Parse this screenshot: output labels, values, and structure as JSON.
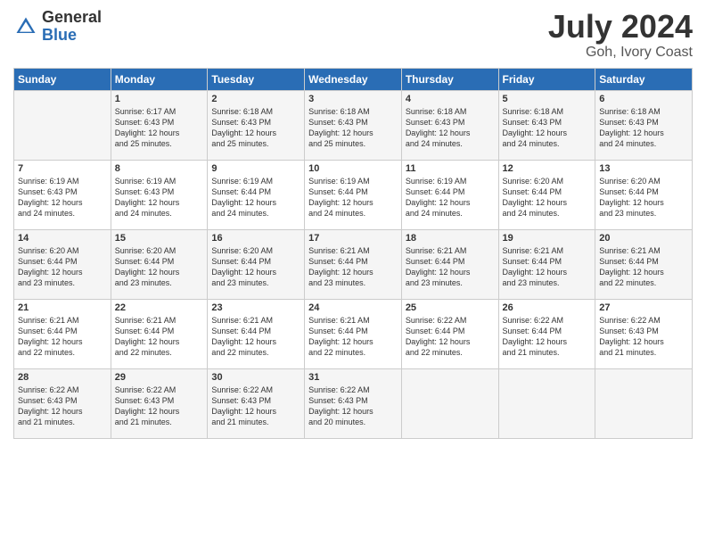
{
  "header": {
    "logo_general": "General",
    "logo_blue": "Blue",
    "month_year": "July 2024",
    "location": "Goh, Ivory Coast"
  },
  "weekdays": [
    "Sunday",
    "Monday",
    "Tuesday",
    "Wednesday",
    "Thursday",
    "Friday",
    "Saturday"
  ],
  "weeks": [
    [
      {
        "day": "",
        "content": ""
      },
      {
        "day": "1",
        "content": "Sunrise: 6:17 AM\nSunset: 6:43 PM\nDaylight: 12 hours\nand 25 minutes."
      },
      {
        "day": "2",
        "content": "Sunrise: 6:18 AM\nSunset: 6:43 PM\nDaylight: 12 hours\nand 25 minutes."
      },
      {
        "day": "3",
        "content": "Sunrise: 6:18 AM\nSunset: 6:43 PM\nDaylight: 12 hours\nand 25 minutes."
      },
      {
        "day": "4",
        "content": "Sunrise: 6:18 AM\nSunset: 6:43 PM\nDaylight: 12 hours\nand 24 minutes."
      },
      {
        "day": "5",
        "content": "Sunrise: 6:18 AM\nSunset: 6:43 PM\nDaylight: 12 hours\nand 24 minutes."
      },
      {
        "day": "6",
        "content": "Sunrise: 6:18 AM\nSunset: 6:43 PM\nDaylight: 12 hours\nand 24 minutes."
      }
    ],
    [
      {
        "day": "7",
        "content": "Sunrise: 6:19 AM\nSunset: 6:43 PM\nDaylight: 12 hours\nand 24 minutes."
      },
      {
        "day": "8",
        "content": "Sunrise: 6:19 AM\nSunset: 6:43 PM\nDaylight: 12 hours\nand 24 minutes."
      },
      {
        "day": "9",
        "content": "Sunrise: 6:19 AM\nSunset: 6:44 PM\nDaylight: 12 hours\nand 24 minutes."
      },
      {
        "day": "10",
        "content": "Sunrise: 6:19 AM\nSunset: 6:44 PM\nDaylight: 12 hours\nand 24 minutes."
      },
      {
        "day": "11",
        "content": "Sunrise: 6:19 AM\nSunset: 6:44 PM\nDaylight: 12 hours\nand 24 minutes."
      },
      {
        "day": "12",
        "content": "Sunrise: 6:20 AM\nSunset: 6:44 PM\nDaylight: 12 hours\nand 24 minutes."
      },
      {
        "day": "13",
        "content": "Sunrise: 6:20 AM\nSunset: 6:44 PM\nDaylight: 12 hours\nand 23 minutes."
      }
    ],
    [
      {
        "day": "14",
        "content": "Sunrise: 6:20 AM\nSunset: 6:44 PM\nDaylight: 12 hours\nand 23 minutes."
      },
      {
        "day": "15",
        "content": "Sunrise: 6:20 AM\nSunset: 6:44 PM\nDaylight: 12 hours\nand 23 minutes."
      },
      {
        "day": "16",
        "content": "Sunrise: 6:20 AM\nSunset: 6:44 PM\nDaylight: 12 hours\nand 23 minutes."
      },
      {
        "day": "17",
        "content": "Sunrise: 6:21 AM\nSunset: 6:44 PM\nDaylight: 12 hours\nand 23 minutes."
      },
      {
        "day": "18",
        "content": "Sunrise: 6:21 AM\nSunset: 6:44 PM\nDaylight: 12 hours\nand 23 minutes."
      },
      {
        "day": "19",
        "content": "Sunrise: 6:21 AM\nSunset: 6:44 PM\nDaylight: 12 hours\nand 23 minutes."
      },
      {
        "day": "20",
        "content": "Sunrise: 6:21 AM\nSunset: 6:44 PM\nDaylight: 12 hours\nand 22 minutes."
      }
    ],
    [
      {
        "day": "21",
        "content": "Sunrise: 6:21 AM\nSunset: 6:44 PM\nDaylight: 12 hours\nand 22 minutes."
      },
      {
        "day": "22",
        "content": "Sunrise: 6:21 AM\nSunset: 6:44 PM\nDaylight: 12 hours\nand 22 minutes."
      },
      {
        "day": "23",
        "content": "Sunrise: 6:21 AM\nSunset: 6:44 PM\nDaylight: 12 hours\nand 22 minutes."
      },
      {
        "day": "24",
        "content": "Sunrise: 6:21 AM\nSunset: 6:44 PM\nDaylight: 12 hours\nand 22 minutes."
      },
      {
        "day": "25",
        "content": "Sunrise: 6:22 AM\nSunset: 6:44 PM\nDaylight: 12 hours\nand 22 minutes."
      },
      {
        "day": "26",
        "content": "Sunrise: 6:22 AM\nSunset: 6:44 PM\nDaylight: 12 hours\nand 21 minutes."
      },
      {
        "day": "27",
        "content": "Sunrise: 6:22 AM\nSunset: 6:43 PM\nDaylight: 12 hours\nand 21 minutes."
      }
    ],
    [
      {
        "day": "28",
        "content": "Sunrise: 6:22 AM\nSunset: 6:43 PM\nDaylight: 12 hours\nand 21 minutes."
      },
      {
        "day": "29",
        "content": "Sunrise: 6:22 AM\nSunset: 6:43 PM\nDaylight: 12 hours\nand 21 minutes."
      },
      {
        "day": "30",
        "content": "Sunrise: 6:22 AM\nSunset: 6:43 PM\nDaylight: 12 hours\nand 21 minutes."
      },
      {
        "day": "31",
        "content": "Sunrise: 6:22 AM\nSunset: 6:43 PM\nDaylight: 12 hours\nand 20 minutes."
      },
      {
        "day": "",
        "content": ""
      },
      {
        "day": "",
        "content": ""
      },
      {
        "day": "",
        "content": ""
      }
    ]
  ]
}
